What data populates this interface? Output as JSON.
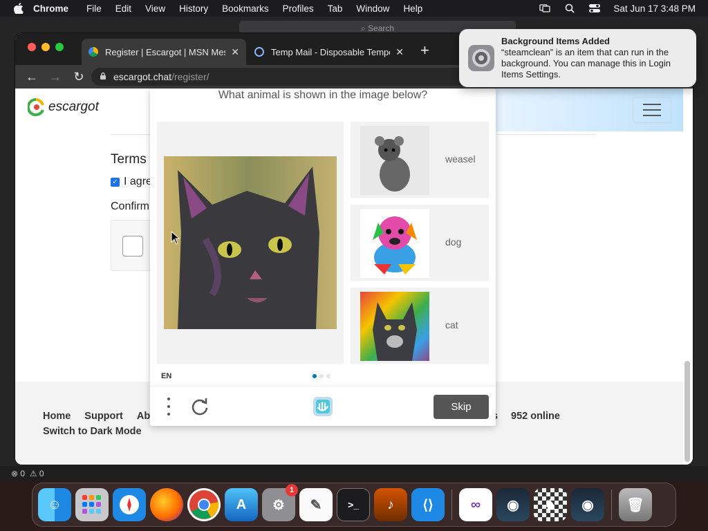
{
  "menubar": {
    "app_name": "Chrome",
    "items": [
      "File",
      "Edit",
      "View",
      "History",
      "Bookmarks",
      "Profiles",
      "Tab",
      "Window",
      "Help"
    ],
    "clock": "Sat Jun 17  3:48 PM"
  },
  "background_window": {
    "search_placeholder": "Search",
    "status_errors": "0",
    "status_warnings": "0"
  },
  "browser": {
    "tabs": [
      {
        "title": "Register | Escargot | MSN Messenger",
        "active": true
      },
      {
        "title": "Temp Mail - Disposable Temporary Email",
        "active": false
      }
    ],
    "url_host": "escargot.chat",
    "url_path": "/register/"
  },
  "page": {
    "logo_text": "escargot",
    "terms_heading": "Terms",
    "agree_text": "I agre",
    "confirm_text": "Confirm",
    "footer": {
      "links": [
        "Home",
        "Support",
        "Abo"
      ],
      "dark_mode": "Switch to Dark Mode",
      "partial": "s",
      "online": "952 online"
    }
  },
  "captcha": {
    "prompt": "What animal is shown in the image below?",
    "options": [
      {
        "label": "weasel",
        "icon": "weasel-sketch-image"
      },
      {
        "label": "dog",
        "icon": "colorful-dog-image"
      },
      {
        "label": "cat",
        "icon": "rainbow-cat-image"
      }
    ],
    "main_image": "black-cat-painting",
    "language": "EN",
    "skip_label": "Skip"
  },
  "notification": {
    "title": "Background Items Added",
    "body": "“steamclean” is an item that can run in the background. You can manage this in Login Items Settings."
  },
  "dock": {
    "apps": [
      "Finder",
      "Launchpad",
      "Safari",
      "Firefox",
      "Chrome",
      "App Store",
      "System Settings",
      "TextEdit",
      "Terminal",
      "GarageBand",
      "VS Code",
      "Visual Studio",
      "Steam",
      "Chess",
      "Steam",
      "Trash"
    ],
    "settings_badge": "1"
  }
}
